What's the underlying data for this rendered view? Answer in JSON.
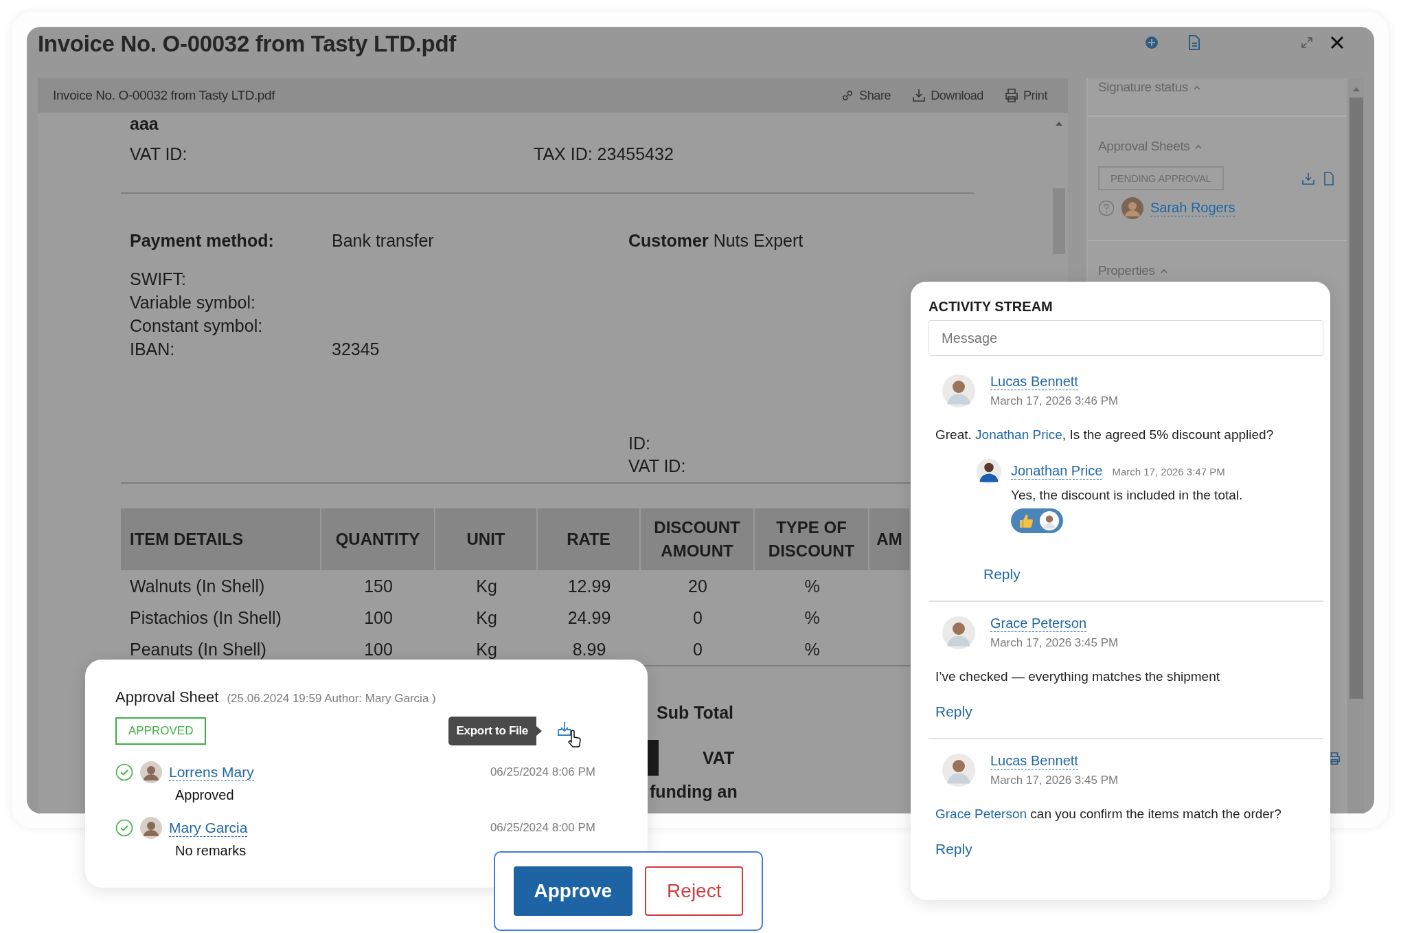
{
  "window": {
    "title": "Invoice No. O-00032 from Tasty LTD.pdf"
  },
  "viewer": {
    "file_name": "Invoice No. O-00032 from Tasty LTD.pdf",
    "actions": [
      {
        "kind": "share",
        "label": "Share"
      },
      {
        "kind": "download",
        "label": "Download"
      },
      {
        "kind": "print",
        "label": "Print"
      }
    ]
  },
  "document": {
    "top_line": "aaa",
    "vat_id_label": "VAT ID:",
    "tax_id": "TAX ID: 23455432",
    "payment_method_label": "Payment method:",
    "payment_method": "Bank transfer",
    "customer_label": "Customer",
    "customer": "Nuts Expert",
    "bank_fields": [
      {
        "label": "SWIFT:"
      },
      {
        "label": "Variable symbol:"
      },
      {
        "label": "Constant symbol:"
      },
      {
        "label": "IBAN:",
        "value": "32345"
      }
    ],
    "customer_fields": [
      {
        "label": "ID:"
      },
      {
        "label": "VAT ID:"
      }
    ],
    "table": {
      "columns": [
        "ITEM DETAILS",
        "QUANTITY",
        "UNIT",
        "RATE",
        "DISCOUNT AMOUNT",
        "TYPE OF DISCOUNT",
        "AM"
      ],
      "rows": [
        [
          "Walnuts (In Shell)",
          "150",
          "Kg",
          "12.99",
          "20",
          "%"
        ],
        [
          "Pistachios (In Shell)",
          "100",
          "Kg",
          "24.99",
          "0",
          "%"
        ],
        [
          "Peanuts (In Shell)",
          "100",
          "Kg",
          "8.99",
          "0",
          "%"
        ]
      ]
    },
    "totals": [
      {
        "label": "Sub Total"
      },
      {
        "label": "VAT"
      }
    ],
    "footer_fragment": "funding an"
  },
  "side_panel": {
    "sections": [
      {
        "title": "Signature status",
        "expanded": true
      },
      {
        "title": "Approval Sheets",
        "expanded": true
      },
      {
        "title": "Properties",
        "expanded": true
      }
    ],
    "approval_status": "PENDING APPROVAL",
    "approver": {
      "name": "Sarah Rogers",
      "approved": false
    }
  },
  "approval_sheet": {
    "title": "Approval Sheet",
    "meta": "(25.06.2024 19:59 Author: Mary Garcia )",
    "status": "APPROVED",
    "tooltip": "Export to File",
    "approvers": [
      {
        "name": "Lorrens Mary",
        "note": "Approved",
        "time": "06/25/2024 8:06 PM",
        "approved": true
      },
      {
        "name": "Mary Garcia",
        "note": "No remarks",
        "time": "06/25/2024 8:00 PM",
        "approved": true
      }
    ]
  },
  "decision": {
    "buttons": [
      {
        "kind": "primary",
        "label": "Approve"
      },
      {
        "kind": "danger",
        "label": "Reject"
      }
    ]
  },
  "activity": {
    "title": "ACTIVITY STREAM",
    "placeholder": "Message",
    "comments": [
      {
        "author": "Lucas Bennett",
        "time": "March 17, 2026 3:46 PM",
        "text": [
          {
            "kind": "plain",
            "text": "Great. "
          },
          {
            "kind": "mention",
            "text": "Jonathan Price"
          },
          {
            "kind": "plain",
            "text": ", Is the agreed 5% discount applied?"
          }
        ],
        "reply_label": "Reply",
        "replies": [
          {
            "author": "Jonathan Price",
            "time": "March 17, 2026 3:47 PM",
            "text": [
              {
                "kind": "plain",
                "text": "Yes, the discount is included in the total."
              }
            ],
            "reactions": [
              {
                "kind": "like"
              }
            ]
          }
        ]
      },
      {
        "author": "Grace Peterson",
        "time": "March 17, 2026 3:45 PM",
        "text": [
          {
            "kind": "plain",
            "text": "I’ve checked — everything matches the shipment"
          }
        ],
        "reply_label": "Reply"
      },
      {
        "author": "Lucas Bennett",
        "time": "March 17, 2026 3:45 PM",
        "text": [
          {
            "kind": "mention",
            "text": "Grace Peterson"
          },
          {
            "kind": "plain",
            "text": " can you confirm the items match the order?"
          }
        ],
        "reply_label": "Reply"
      }
    ]
  }
}
